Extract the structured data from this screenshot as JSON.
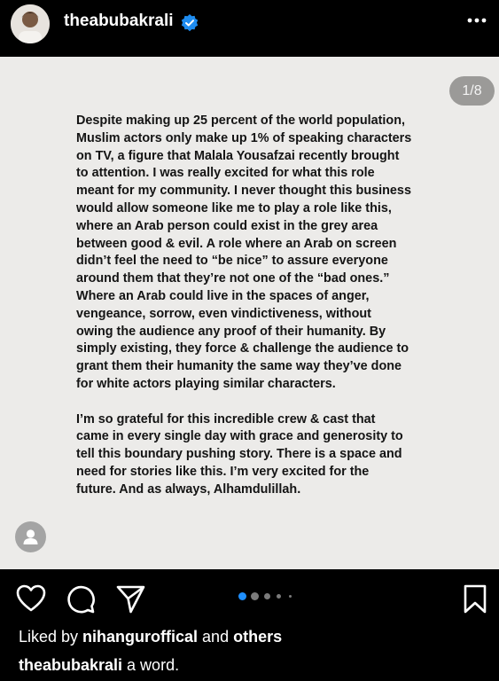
{
  "header": {
    "username": "theabubakrali",
    "verified": true,
    "more_icon": "ellipsis-icon"
  },
  "post": {
    "slide_counter": "1/8",
    "paragraphs": [
      "Despite making up 25 percent of the world population,\nMuslim actors only make up 1% of speaking characters\non TV, a figure that Malala Yousafzai recently brought\nto attention. I was really excited for what this role\nmeant for my community. I never thought this business\nwould allow someone like me to play a role like this,\nwhere an Arab person could exist in the grey area\nbetween good & evil. A role where an Arab on screen\ndidn’t feel the need to “be nice” to assure everyone\naround them that they’re not one of the “bad ones.”\nWhere an Arab could live in the spaces of anger,\nvengeance, sorrow, even vindictiveness, without\nowing the audience any proof of their humanity. By\nsimply existing, they force & challenge the audience to\ngrant them their humanity the same way they’ve done\nfor white actors playing similar characters.",
      "I’m so grateful for this incredible crew & cast that\ncame in every single day with grace and generosity to\ntell this boundary pushing story. There is a space and\nneed for stories like this. I’m very excited for the\nfuture. And as always, Alhamdulillah."
    ],
    "tag_icon": "person-tag-icon"
  },
  "actions": {
    "like_icon": "heart-icon",
    "comment_icon": "comment-icon",
    "share_icon": "send-icon",
    "save_icon": "bookmark-icon",
    "active_dot_color": "#1f8fff"
  },
  "likes": {
    "prefix": "Liked by ",
    "user": "nihanguroffical",
    "middle": " and ",
    "others": "others"
  },
  "caption": {
    "user": "theabubakrali",
    "text": " a word."
  }
}
